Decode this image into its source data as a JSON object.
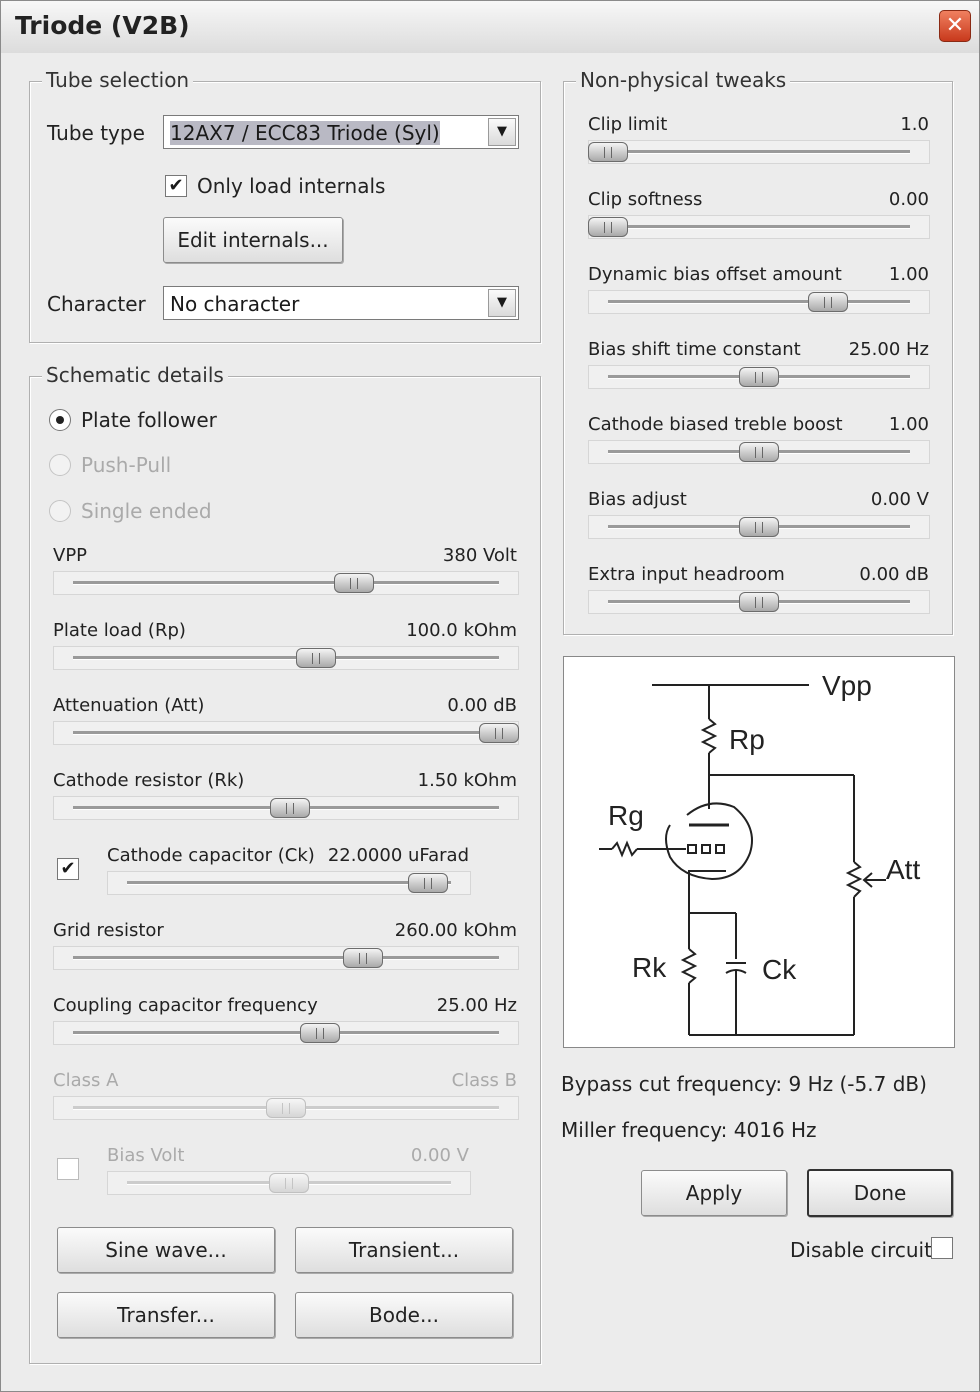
{
  "window": {
    "title": "Triode (V2B)",
    "close_glyph": "✕"
  },
  "tube_selection": {
    "legend": "Tube selection",
    "tube_type_label": "Tube type",
    "tube_type_value": "12AX7 / ECC83 Triode (Syl)",
    "only_load_internals_label": "Only load internals",
    "only_load_internals_checked": true,
    "edit_internals_button": "Edit internals...",
    "character_label": "Character",
    "character_value": "No character",
    "dropdown_arrow": "▼",
    "check_glyph": "✔"
  },
  "schematic_details": {
    "legend": "Schematic details",
    "radios": [
      {
        "label": "Plate follower",
        "selected": true,
        "enabled": true
      },
      {
        "label": "Push-Pull",
        "selected": false,
        "enabled": false
      },
      {
        "label": "Single ended",
        "selected": false,
        "enabled": false
      }
    ],
    "sliders": [
      {
        "label": "VPP",
        "value": "380 Volt",
        "position": 0.66
      },
      {
        "label": "Plate load (Rp)",
        "value": "100.0 kOhm",
        "position": 0.57
      },
      {
        "label": "Attenuation (Att)",
        "value": "0.00 dB",
        "position": 1.0
      },
      {
        "label": "Cathode resistor (Rk)",
        "value": "1.50 kOhm",
        "position": 0.51
      },
      {
        "label": "Cathode capacitor (Ck)",
        "value": "22.0000 uFarad",
        "position": 0.93
      },
      {
        "label": "Grid resistor",
        "value": "260.00 kOhm",
        "position": 0.68
      },
      {
        "label": "Coupling capacitor frequency",
        "value": "25.00 Hz",
        "position": 0.58
      },
      {
        "label_left": "Class A",
        "label_right": "Class B",
        "position": 0.5
      },
      {
        "label": "Bias Volt",
        "value": "0.00 V",
        "position": 0.5
      }
    ],
    "cathode_capacitor_checked": true,
    "bias_volt_checked": false,
    "buttons": [
      "Sine wave...",
      "Transient...",
      "Transfer...",
      "Bode..."
    ]
  },
  "non_physical_tweaks": {
    "legend": "Non-physical tweaks",
    "sliders": [
      {
        "label": "Clip limit",
        "value": "1.0",
        "position": 0.0
      },
      {
        "label": "Clip softness",
        "value": "0.00",
        "position": 0.0
      },
      {
        "label": "Dynamic bias offset amount",
        "value": "1.00",
        "position": 0.73
      },
      {
        "label": "Bias shift time constant",
        "value": "25.00 Hz",
        "position": 0.5
      },
      {
        "label": "Cathode biased treble boost",
        "value": "1.00",
        "position": 0.5
      },
      {
        "label": "Bias adjust",
        "value": "0.00 V",
        "position": 0.5
      },
      {
        "label": "Extra input headroom",
        "value": "0.00 dB",
        "position": 0.5
      }
    ]
  },
  "schematic": {
    "vpp": "Vpp",
    "rp": "Rp",
    "rg": "Rg",
    "att": "Att",
    "rk": "Rk",
    "ck": "Ck"
  },
  "info": {
    "bypass": "Bypass cut frequency: 9 Hz (-5.7 dB)",
    "miller": "Miller frequency: 4016 Hz"
  },
  "actions": {
    "apply": "Apply",
    "done": "Done",
    "disable_circuit": "Disable circuit",
    "disable_circuit_checked": false
  }
}
